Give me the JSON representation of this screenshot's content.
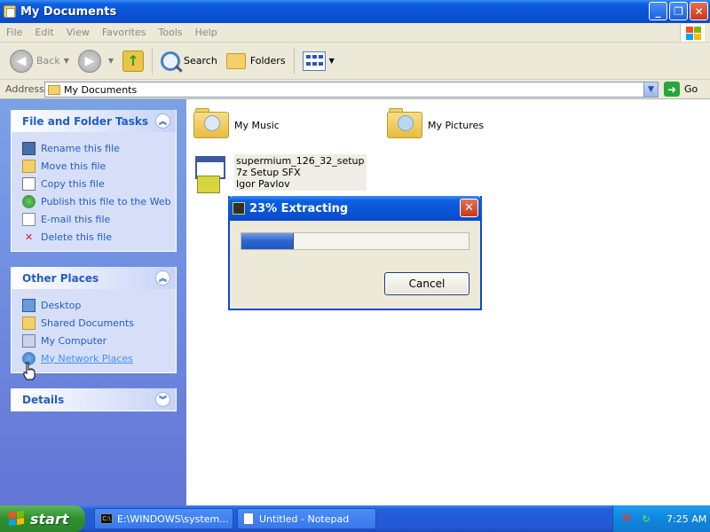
{
  "window": {
    "title": "My Documents"
  },
  "menu": [
    "File",
    "Edit",
    "View",
    "Favorites",
    "Tools",
    "Help"
  ],
  "toolbar": {
    "back": "Back",
    "search": "Search",
    "folders": "Folders"
  },
  "address": {
    "label": "Address",
    "value": "My Documents",
    "go": "Go"
  },
  "file_tasks": {
    "title": "File and Folder Tasks",
    "items": [
      "Rename this file",
      "Move this file",
      "Copy this file",
      "Publish this file to the Web",
      "E-mail this file",
      "Delete this file"
    ]
  },
  "other_places": {
    "title": "Other Places",
    "items": [
      "Desktop",
      "Shared Documents",
      "My Computer",
      "My Network Places"
    ]
  },
  "details": {
    "title": "Details"
  },
  "files": [
    {
      "name": "My Music"
    },
    {
      "name": "My Pictures"
    },
    {
      "name": "supermium_126_32_setup",
      "type": "7z Setup SFX",
      "author": "Igor Pavlov"
    }
  ],
  "dialog": {
    "title": "23% Extracting",
    "progress": 0.23,
    "cancel": "Cancel"
  },
  "taskbar": {
    "start": "start",
    "buttons": [
      "E:\\WINDOWS\\system...",
      "Untitled - Notepad"
    ],
    "cmd_glyph": "C:\\",
    "clock": "7:25 AM"
  }
}
